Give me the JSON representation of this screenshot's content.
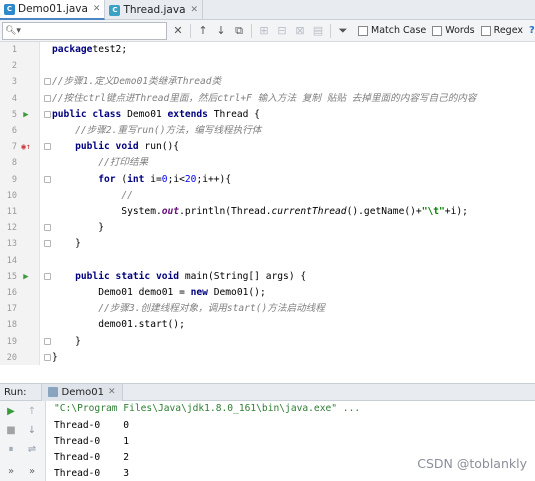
{
  "tabs": [
    {
      "label": "Demo01.java",
      "active": true,
      "icon": "class-icon"
    },
    {
      "label": "Thread.java",
      "active": false,
      "icon": "class-icon"
    }
  ],
  "search": {
    "value": "",
    "options": [
      "Match Case",
      "Words",
      "Regex"
    ],
    "help": "?"
  },
  "editor": {
    "lines": [
      {
        "n": "1",
        "html": [
          [
            "kw",
            "package"
          ],
          [
            "",
            "test2;"
          ]
        ]
      },
      {
        "n": "2",
        "html": []
      },
      {
        "n": "3",
        "html": [
          [
            "cm",
            "//步骤1.定义Demo01类继承Thread类"
          ]
        ]
      },
      {
        "n": "4",
        "html": [
          [
            "cm",
            "//按住ctrl键点进Thread里面，然后ctrl+F 输入方法 复制 贴贴 去掉里面的内容写自己的内容"
          ]
        ]
      },
      {
        "n": "5",
        "html": [
          [
            "kw",
            "public class "
          ],
          [
            "",
            "Demo01 "
          ],
          [
            "kw",
            "extends "
          ],
          [
            "",
            "Thread {"
          ]
        ]
      },
      {
        "n": "6",
        "html": [
          [
            "",
            "    "
          ],
          [
            "cm",
            "//步骤2.重写run()方法，编写线程执行体"
          ]
        ]
      },
      {
        "n": "7",
        "html": [
          [
            "",
            "    "
          ],
          [
            "kw",
            "public void "
          ],
          [
            "",
            "run(){"
          ]
        ]
      },
      {
        "n": "8",
        "html": [
          [
            "",
            "        "
          ],
          [
            "cm",
            "//打印结果"
          ]
        ]
      },
      {
        "n": "9",
        "html": [
          [
            "",
            "        "
          ],
          [
            "kw",
            "for "
          ],
          [
            "",
            "("
          ],
          [
            "kw",
            "int "
          ],
          [
            "",
            "i="
          ],
          [
            "num",
            "0"
          ],
          [
            "",
            ";i<"
          ],
          [
            "num",
            "20"
          ],
          [
            "",
            ";i++){"
          ]
        ]
      },
      {
        "n": "10",
        "html": [
          [
            "",
            "            "
          ],
          [
            "cm",
            "//"
          ]
        ]
      },
      {
        "n": "11",
        "html": [
          [
            "",
            "            System."
          ],
          [
            "fld",
            "out"
          ],
          [
            "",
            ".println(Thread."
          ],
          [
            "ital",
            "currentThread"
          ],
          [
            "",
            "().getName()+"
          ],
          [
            "str",
            "\"\\t\""
          ],
          [
            "",
            "+i);"
          ]
        ]
      },
      {
        "n": "12",
        "html": [
          [
            "",
            "        }"
          ]
        ]
      },
      {
        "n": "13",
        "html": [
          [
            "",
            "    }"
          ]
        ]
      },
      {
        "n": "14",
        "html": []
      },
      {
        "n": "15",
        "html": [
          [
            "",
            "    "
          ],
          [
            "kw",
            "public static void "
          ],
          [
            "",
            "main(String[] args) {"
          ]
        ]
      },
      {
        "n": "16",
        "html": [
          [
            "",
            "        Demo01 demo01 = "
          ],
          [
            "kw",
            "new "
          ],
          [
            "",
            "Demo01();"
          ]
        ]
      },
      {
        "n": "17",
        "html": [
          [
            "",
            "        "
          ],
          [
            "cm",
            "//步骤3.创建线程对象，调用start()方法启动线程"
          ]
        ]
      },
      {
        "n": "18",
        "html": [
          [
            "",
            "        demo01.start();"
          ]
        ]
      },
      {
        "n": "19",
        "html": [
          [
            "",
            "    }"
          ]
        ]
      },
      {
        "n": "20",
        "html": [
          [
            "",
            "}"
          ]
        ]
      }
    ]
  },
  "run": {
    "label": "Run:",
    "tab": "Demo01",
    "command": "\"C:\\Program Files\\Java\\jdk1.8.0_161\\bin\\java.exe\" ...",
    "output": [
      "Thread-0    0",
      "Thread-0    1",
      "Thread-0    2",
      "Thread-0    3"
    ]
  },
  "watermark": "CSDN @toblankly"
}
